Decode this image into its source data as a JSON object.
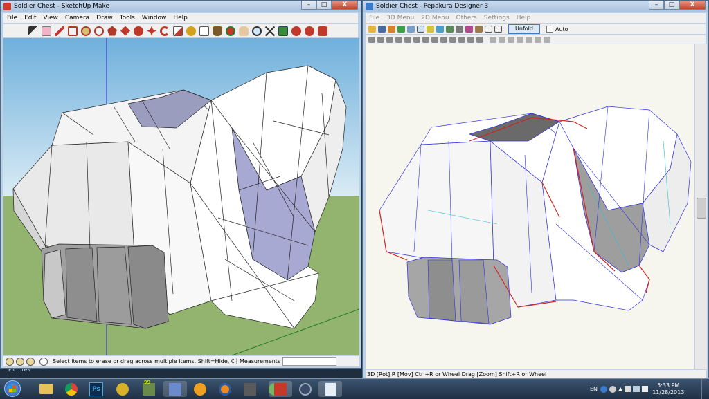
{
  "left_window": {
    "title": "Soldier Chest - SketchUp Make",
    "menu": [
      "File",
      "Edit",
      "View",
      "Camera",
      "Draw",
      "Tools",
      "Window",
      "Help"
    ],
    "status_hint": "Select items to erase or drag across multiple items. Shift=Hide, Ctrl=Soften/Smo...",
    "measurements_label": "Measurements"
  },
  "right_window": {
    "title": "Soldier Chest - Pepakura Designer 3",
    "menu": [
      "File",
      "3D Menu",
      "2D Menu",
      "Others",
      "Settings",
      "Help"
    ],
    "unfold_label": "Unfold",
    "auto_label": "Auto",
    "status_text": "3D [Rot] R [Mov] Ctrl+R or Wheel Drag [Zoom] Shift+R or Wheel"
  },
  "window_controls": {
    "minimize": "–",
    "maximize": "□",
    "close": "X"
  },
  "desktop": {
    "pictures_label": "Pictures"
  },
  "tray": {
    "language": "EN",
    "time": "5:33 PM",
    "date": "11/28/2013"
  },
  "taskbar_badge": "99",
  "colors": {
    "sky_top": "#7ab6de",
    "ground": "#93b46e",
    "model_face": "#f4f4f4",
    "model_back": "#a7a9d2",
    "pepakura_bg": "#f7f6ee",
    "cut_line": "#d42020",
    "fold_line": "#2e2ee0"
  }
}
